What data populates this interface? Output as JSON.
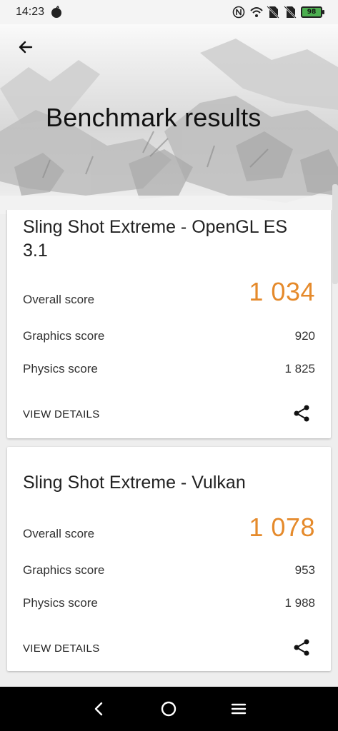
{
  "status_bar": {
    "time": "14:23",
    "battery_level": "98",
    "icons": [
      "app-notification-icon",
      "nfc-icon",
      "wifi-icon",
      "no-sim-icon",
      "no-sim-icon",
      "battery-icon"
    ]
  },
  "header": {
    "title": "Benchmark results",
    "back_icon": "arrow-left-icon"
  },
  "results": [
    {
      "title": "Sling Shot Extreme - OpenGL ES 3.1",
      "overall_label": "Overall score",
      "overall_value": "1 034",
      "graphics_label": "Graphics score",
      "graphics_value": "920",
      "physics_label": "Physics score",
      "physics_value": "1 825",
      "details_label": "VIEW DETAILS",
      "share_icon": "share-icon"
    },
    {
      "title": "Sling Shot Extreme - Vulkan",
      "overall_label": "Overall score",
      "overall_value": "1 078",
      "graphics_label": "Graphics score",
      "graphics_value": "953",
      "physics_label": "Physics score",
      "physics_value": "1 988",
      "details_label": "VIEW DETAILS",
      "share_icon": "share-icon"
    }
  ],
  "nav_bar": {
    "buttons": [
      "back-icon",
      "home-icon",
      "menu-icon"
    ]
  },
  "colors": {
    "accent_score": "#e58a2b",
    "battery_fill": "#4caf50",
    "nav_background": "#000000"
  }
}
